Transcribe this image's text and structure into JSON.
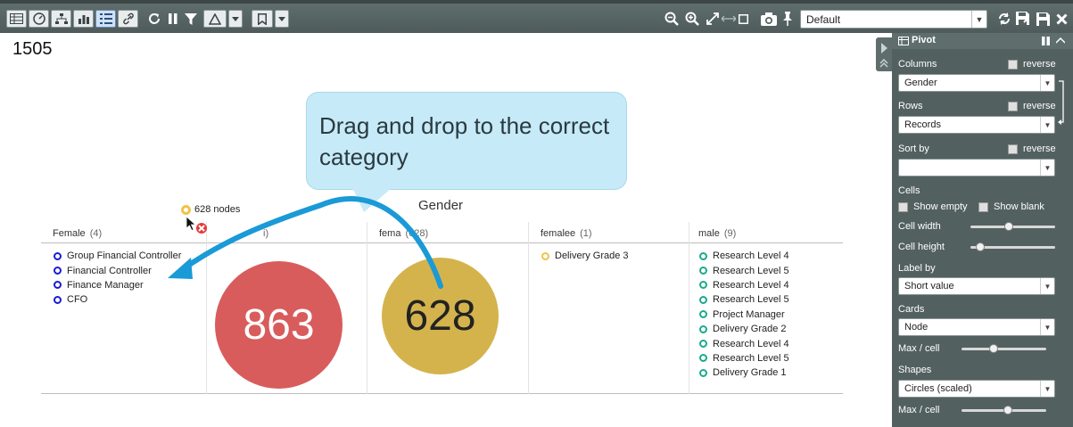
{
  "toolbar": {
    "icons": [
      "table-view-icon",
      "dashboard-icon",
      "hierarchy-icon",
      "bar-chart-icon",
      "list-view-icon",
      "link-icon",
      "refresh-icon",
      "pause-icon",
      "filter-icon",
      "delta-icon",
      "bookmark-icon",
      "zoom-out-icon",
      "zoom-in-icon",
      "fit-icon",
      "camera-icon",
      "pin-icon",
      "reload-icon",
      "save-as-icon",
      "save-icon",
      "close-icon"
    ],
    "view_select": "Default"
  },
  "page_number": "1505",
  "callout": {
    "text": "Drag and drop to the correct category"
  },
  "drag": {
    "label": "628 nodes"
  },
  "grid": {
    "title": "Gender",
    "columns": [
      {
        "name": "Female",
        "count": "(4)",
        "dot_color": "#1a1ad6",
        "items": [
          "Group Financial Controller",
          "Financial Controller",
          "Finance Manager",
          "CFO"
        ]
      },
      {
        "name": "",
        "count": "i)",
        "bubble_value": "863",
        "bubble_color": "#d85c5c",
        "bubble_text_color": "#ffffff"
      },
      {
        "name": "fema",
        "count": "(628)",
        "bubble_value": "628",
        "bubble_color": "#d4b34d",
        "bubble_text_color": "#222222"
      },
      {
        "name": "femalee",
        "count": "(1)",
        "dot_color": "#f2c24a",
        "items": [
          "Delivery Grade 3"
        ]
      },
      {
        "name": "male",
        "count": "(9)",
        "dot_color": "#1aaa8c",
        "items": [
          "Research Level 4",
          "Research Level 5",
          "Research Level 4",
          "Research Level 5",
          "Project Manager",
          "Delivery Grade 2",
          "Research Level 4",
          "Research Level 5",
          "Delivery Grade 1"
        ]
      }
    ]
  },
  "panel": {
    "title": "Pivot",
    "columns_label": "Columns",
    "columns_value": "Gender",
    "rows_label": "Rows",
    "rows_value": "Records",
    "sort_label": "Sort by",
    "sort_value": "",
    "reverse_label": "reverse",
    "cells_label": "Cells",
    "show_empty": "Show empty",
    "show_blank": "Show blank",
    "cell_width": "Cell width",
    "cell_height": "Cell height",
    "label_by": "Label by",
    "label_value": "Short value",
    "cards_label": "Cards",
    "cards_value": "Node",
    "max_cell": "Max / cell",
    "shapes_label": "Shapes",
    "shapes_value": "Circles (scaled)",
    "sliders": {
      "cell_width": 0.45,
      "cell_height": 0.12,
      "cards_max": 0.38,
      "shapes_max": 0.55
    }
  },
  "colors": {
    "toolbar": "#55625f",
    "panel": "#536060",
    "callout": "#c6eaf8",
    "arrow": "#1a9ad6"
  }
}
